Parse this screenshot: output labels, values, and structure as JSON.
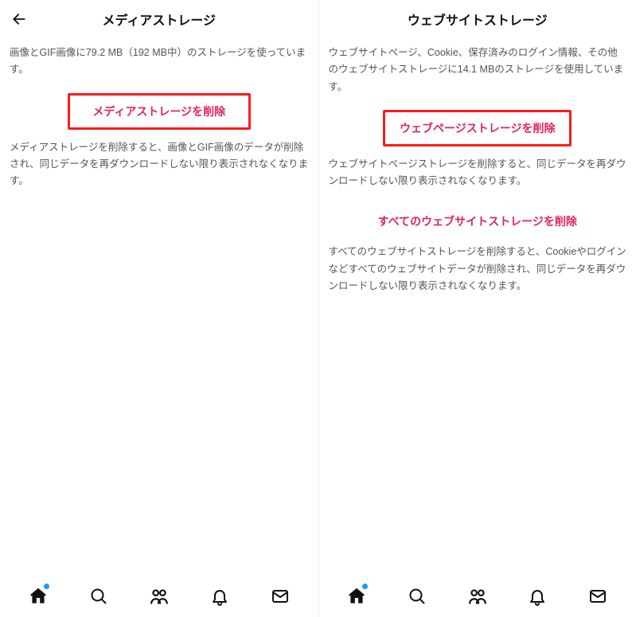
{
  "left": {
    "title": "メディアストレージ",
    "intro": "画像とGIF画像に79.2 MB（192 MB中）のストレージを使っています。",
    "action_label": "メディアストレージを削除",
    "desc": "メディアストレージを削除すると、画像とGIF画像のデータが削除され、同じデータを再ダウンロードしない限り表示されなくなります。"
  },
  "right": {
    "title": "ウェブサイトストレージ",
    "intro": "ウェブサイトページ、Cookie、保存済みのログイン情報、その他のウェブサイトストレージに14.1 MBのストレージを使用しています。",
    "action_label": "ウェブページストレージを削除",
    "desc": "ウェブサイトページストレージを削除すると、同じデータを再ダウンロードしない限り表示されなくなります。",
    "all_action_label": "すべてのウェブサイトストレージを削除",
    "all_desc": "すべてのウェブサイトストレージを削除すると、Cookieやログインなどすべてのウェブサイトデータが削除され、同じデータを再ダウンロードしない限り表示されなくなります。"
  }
}
